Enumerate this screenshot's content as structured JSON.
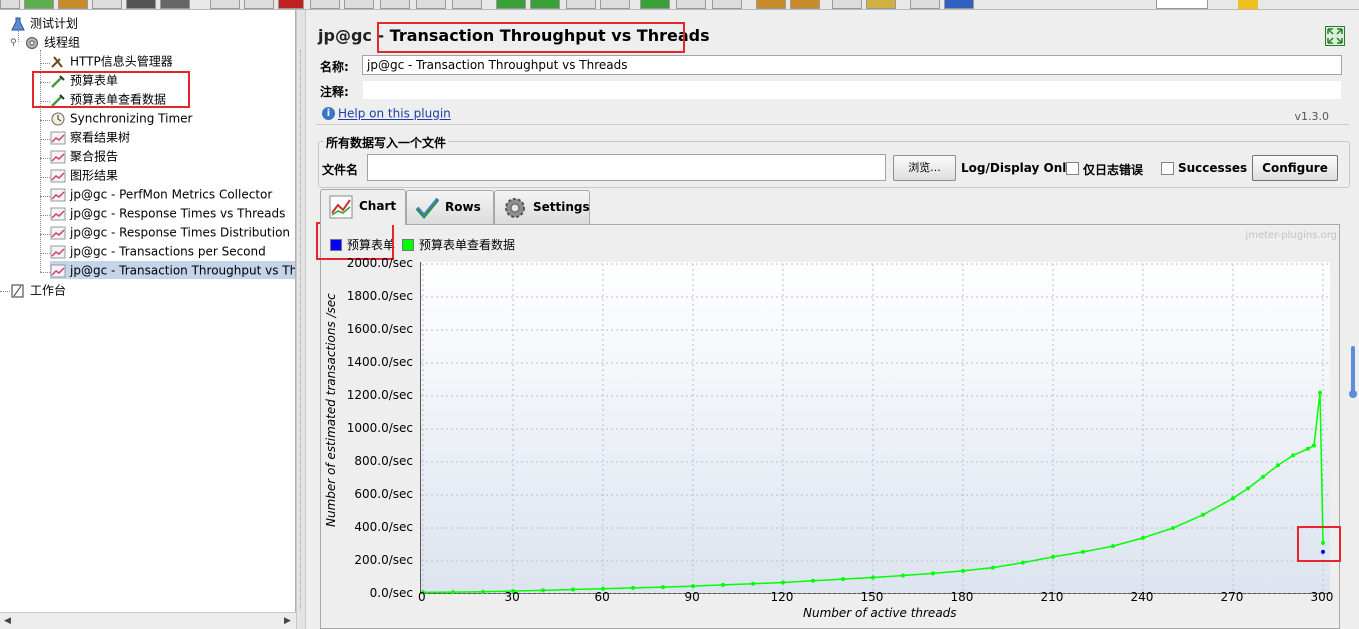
{
  "tree": {
    "items": [
      {
        "label": "测试计划",
        "icon": "test-plan-icon"
      },
      {
        "label": "线程组",
        "icon": "thread-group-icon"
      },
      {
        "label": "HTTP信息头管理器",
        "icon": "wrench-icon"
      },
      {
        "label": "预算表单",
        "icon": "pipette-icon"
      },
      {
        "label": "预算表单查看数据",
        "icon": "pipette-icon"
      },
      {
        "label": "Synchronizing Timer",
        "icon": "timer-icon"
      },
      {
        "label": "察看结果树",
        "icon": "listener-graph-icon"
      },
      {
        "label": "聚合报告",
        "icon": "listener-graph-icon"
      },
      {
        "label": "图形结果",
        "icon": "listener-graph-icon"
      },
      {
        "label": "jp@gc - PerfMon Metrics Collector",
        "icon": "listener-graph-icon"
      },
      {
        "label": "jp@gc - Response Times vs Threads",
        "icon": "listener-graph-icon"
      },
      {
        "label": "jp@gc - Response Times Distribution",
        "icon": "listener-graph-icon"
      },
      {
        "label": "jp@gc - Transactions per Second",
        "icon": "listener-graph-icon"
      },
      {
        "label": "jp@gc - Transaction Throughput vs Threads",
        "icon": "listener-graph-icon"
      },
      {
        "label": "工作台",
        "icon": "workbench-icon"
      }
    ]
  },
  "panel": {
    "title_prefix": "jp@gc - ",
    "title_main": "Transaction Throughput vs Threads",
    "name_label": "名称:",
    "name_value": "jp@gc - Transaction Throughput vs Threads",
    "comment_label": "注释:",
    "comment_value": "",
    "help_link": "Help on this plugin",
    "version": "v1.3.0"
  },
  "file_group": {
    "title": "所有数据写入一个文件",
    "filename_label": "文件名",
    "filename_value": "",
    "browse_label": "浏览...",
    "log_display_label": "Log/Display Only:",
    "errors_only_label": "仅日志错误",
    "errors_only_checked": false,
    "successes_label": "Successes",
    "successes_checked": false,
    "configure_label": "Configure"
  },
  "tabs": [
    {
      "label": "Chart",
      "icon": "chart-icon",
      "active": true
    },
    {
      "label": "Rows",
      "icon": "checkmark-icon",
      "active": false
    },
    {
      "label": "Settings",
      "icon": "gear-icon",
      "active": false
    }
  ],
  "watermark": "jmeter-plugins.org",
  "colors": {
    "series_blue": "#0000ff",
    "series_green": "#00ff00",
    "highlight_red": "#e8252a"
  },
  "chart_data": {
    "type": "line",
    "xlabel": "Number of active threads",
    "ylabel": "Number of estimated transactions /sec",
    "xlim": [
      0,
      300
    ],
    "ylim": [
      0,
      2000
    ],
    "x_ticks": [
      "0",
      "30",
      "60",
      "90",
      "120",
      "150",
      "180",
      "210",
      "240",
      "270",
      "300"
    ],
    "y_ticks": [
      "0.0/sec",
      "200.0/sec",
      "400.0/sec",
      "600.0/sec",
      "800.0/sec",
      "1000.0/sec",
      "1200.0/sec",
      "1400.0/sec",
      "1600.0/sec",
      "1800.0/sec",
      "2000.0/sec"
    ],
    "grid": true,
    "legend_position": "top-left",
    "series": [
      {
        "name": "预算表单",
        "color": "#0000ff",
        "points": [
          [
            300,
            255
          ]
        ]
      },
      {
        "name": "预算表单查看数据",
        "color": "#00ff00",
        "points": [
          [
            0,
            10
          ],
          [
            10,
            11
          ],
          [
            20,
            14
          ],
          [
            30,
            18
          ],
          [
            40,
            22
          ],
          [
            50,
            27
          ],
          [
            60,
            32
          ],
          [
            70,
            37
          ],
          [
            80,
            42
          ],
          [
            90,
            48
          ],
          [
            100,
            55
          ],
          [
            110,
            62
          ],
          [
            120,
            70
          ],
          [
            130,
            80
          ],
          [
            140,
            90
          ],
          [
            150,
            100
          ],
          [
            160,
            112
          ],
          [
            170,
            125
          ],
          [
            180,
            140
          ],
          [
            190,
            160
          ],
          [
            200,
            190
          ],
          [
            210,
            225
          ],
          [
            220,
            255
          ],
          [
            230,
            290
          ],
          [
            240,
            340
          ],
          [
            250,
            400
          ],
          [
            260,
            480
          ],
          [
            270,
            580
          ],
          [
            275,
            640
          ],
          [
            280,
            710
          ],
          [
            285,
            780
          ],
          [
            290,
            840
          ],
          [
            295,
            880
          ],
          [
            297,
            900
          ],
          [
            299,
            1220
          ],
          [
            300,
            310
          ]
        ]
      }
    ]
  }
}
